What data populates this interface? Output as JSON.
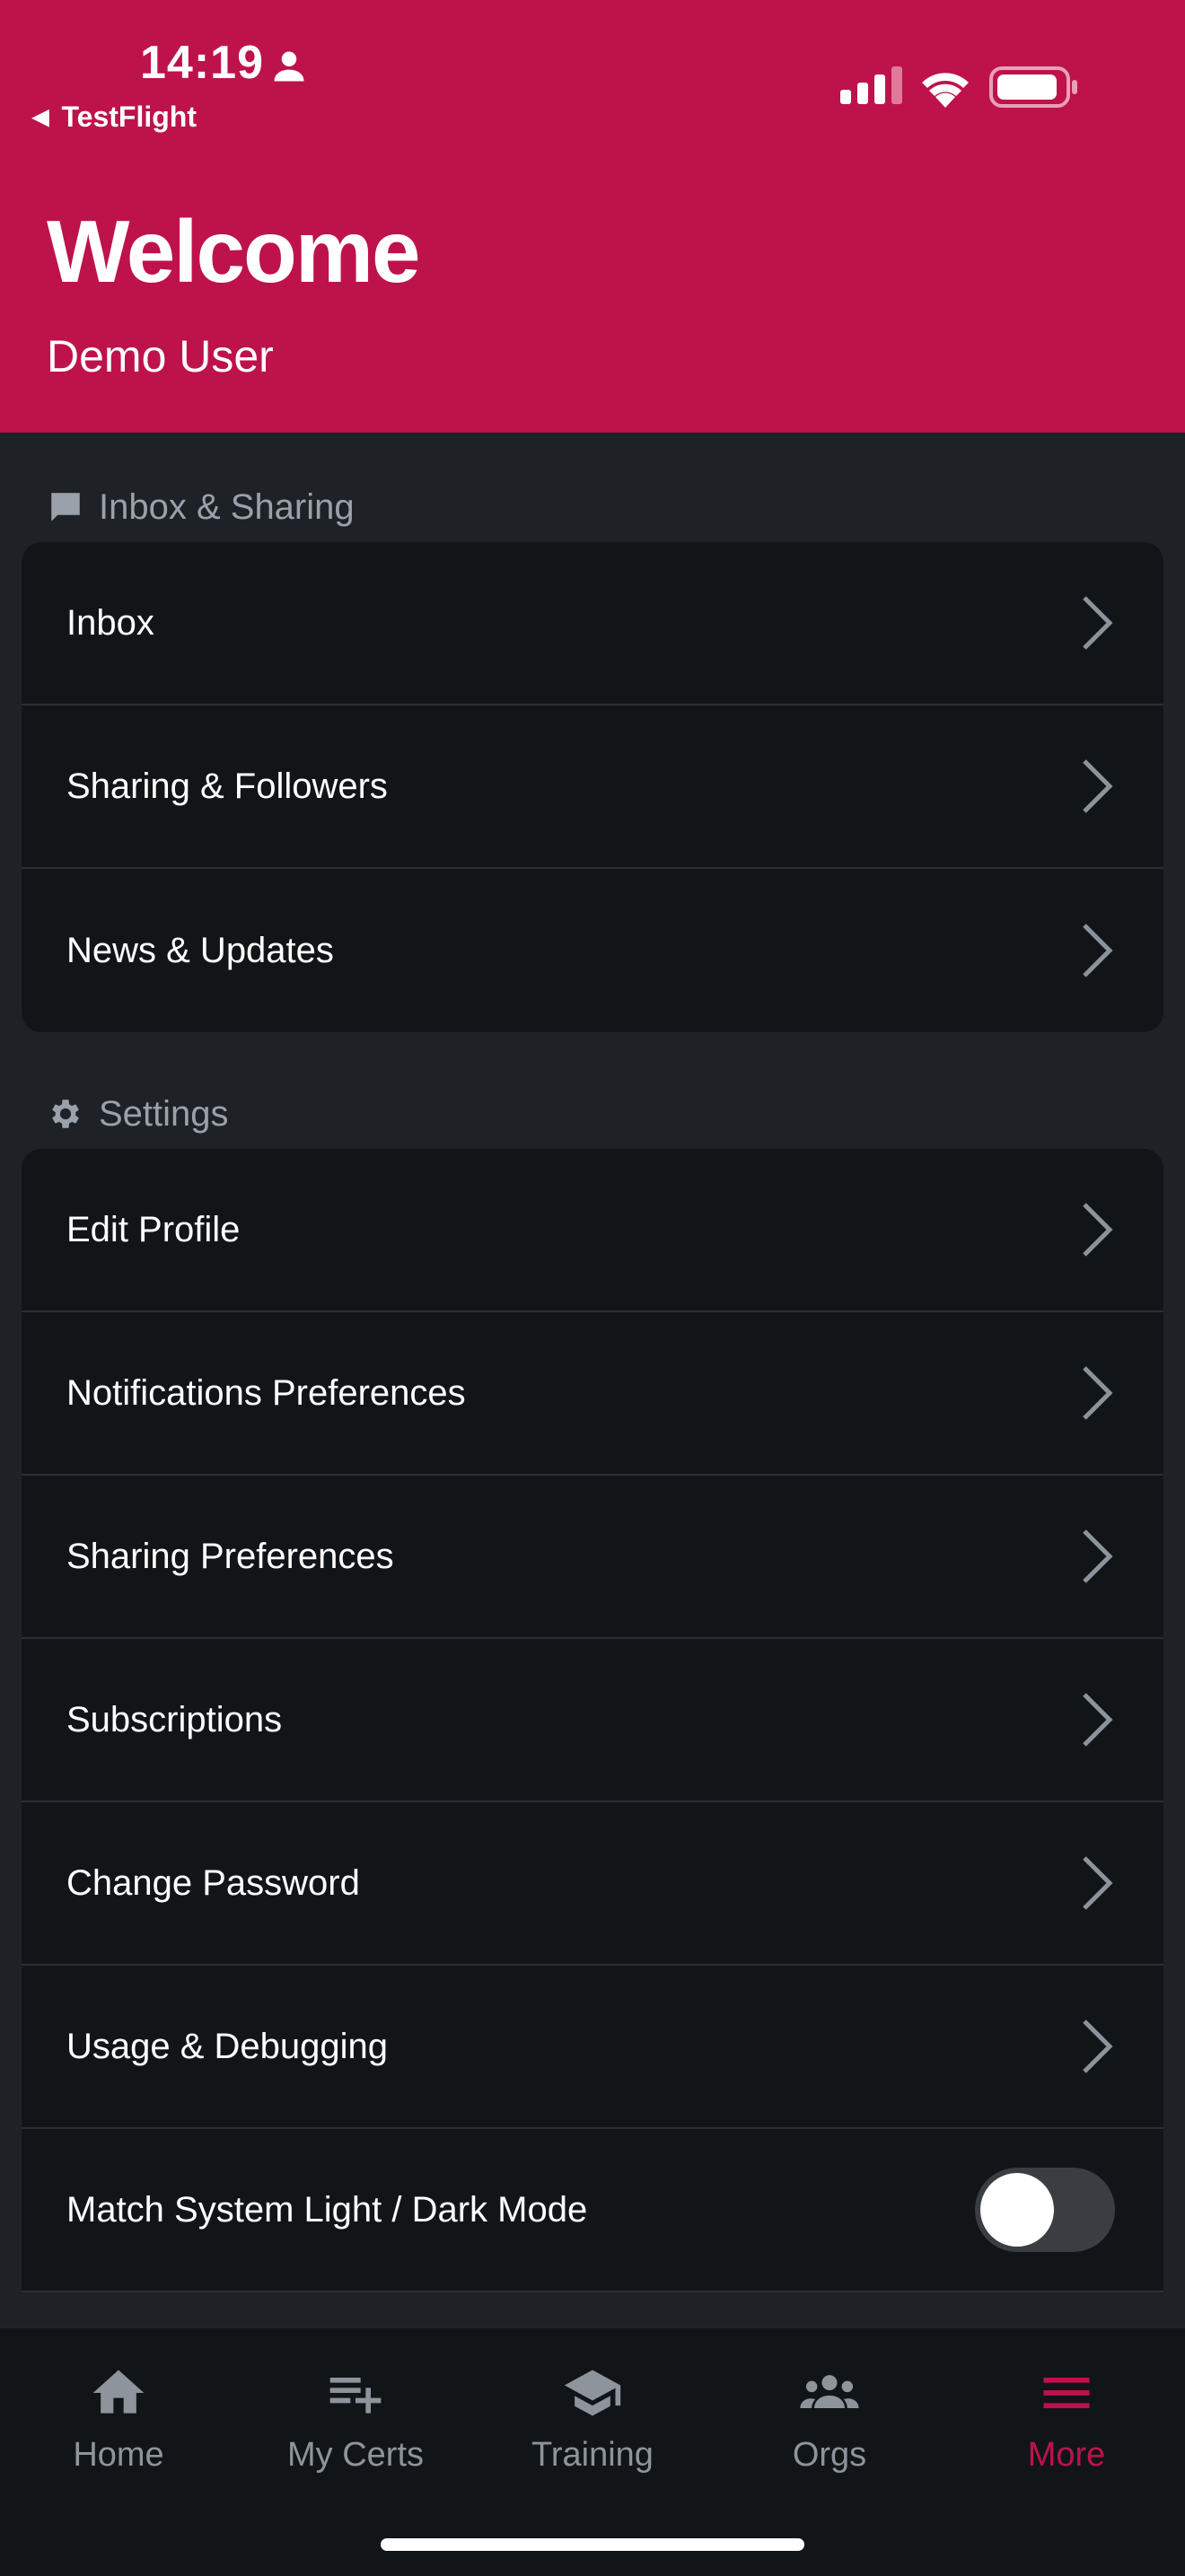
{
  "status_bar": {
    "time": "14:19",
    "back_app": "TestFlight",
    "back_arrow": "◀",
    "icons": [
      "person-icon",
      "signal-icon",
      "wifi-icon",
      "battery-icon"
    ]
  },
  "header": {
    "title": "Welcome",
    "user_name": "Demo User",
    "background_color": "#be124b"
  },
  "sections": {
    "inbox": {
      "label": "Inbox & Sharing",
      "icon": "chat-bubble-icon",
      "items": [
        "Inbox",
        "Sharing & Followers",
        "News & Updates"
      ]
    },
    "settings": {
      "label": "Settings",
      "icon": "gear-icon",
      "items": [
        "Edit Profile",
        "Notifications Preferences",
        "Sharing Preferences",
        "Subscriptions",
        "Change Password",
        "Usage & Debugging"
      ],
      "toggle": {
        "label": "Match System Light / Dark Mode",
        "on": false
      }
    }
  },
  "tabbar": {
    "tabs": [
      {
        "label": "Home",
        "icon": "home-icon",
        "active": false
      },
      {
        "label": "My Certs",
        "icon": "playlist-add-icon",
        "active": false
      },
      {
        "label": "Training",
        "icon": "graduation-cap-icon",
        "active": false
      },
      {
        "label": "Orgs",
        "icon": "group-icon",
        "active": false
      },
      {
        "label": "More",
        "icon": "menu-icon",
        "active": true
      }
    ],
    "active_color": "#be124b"
  }
}
